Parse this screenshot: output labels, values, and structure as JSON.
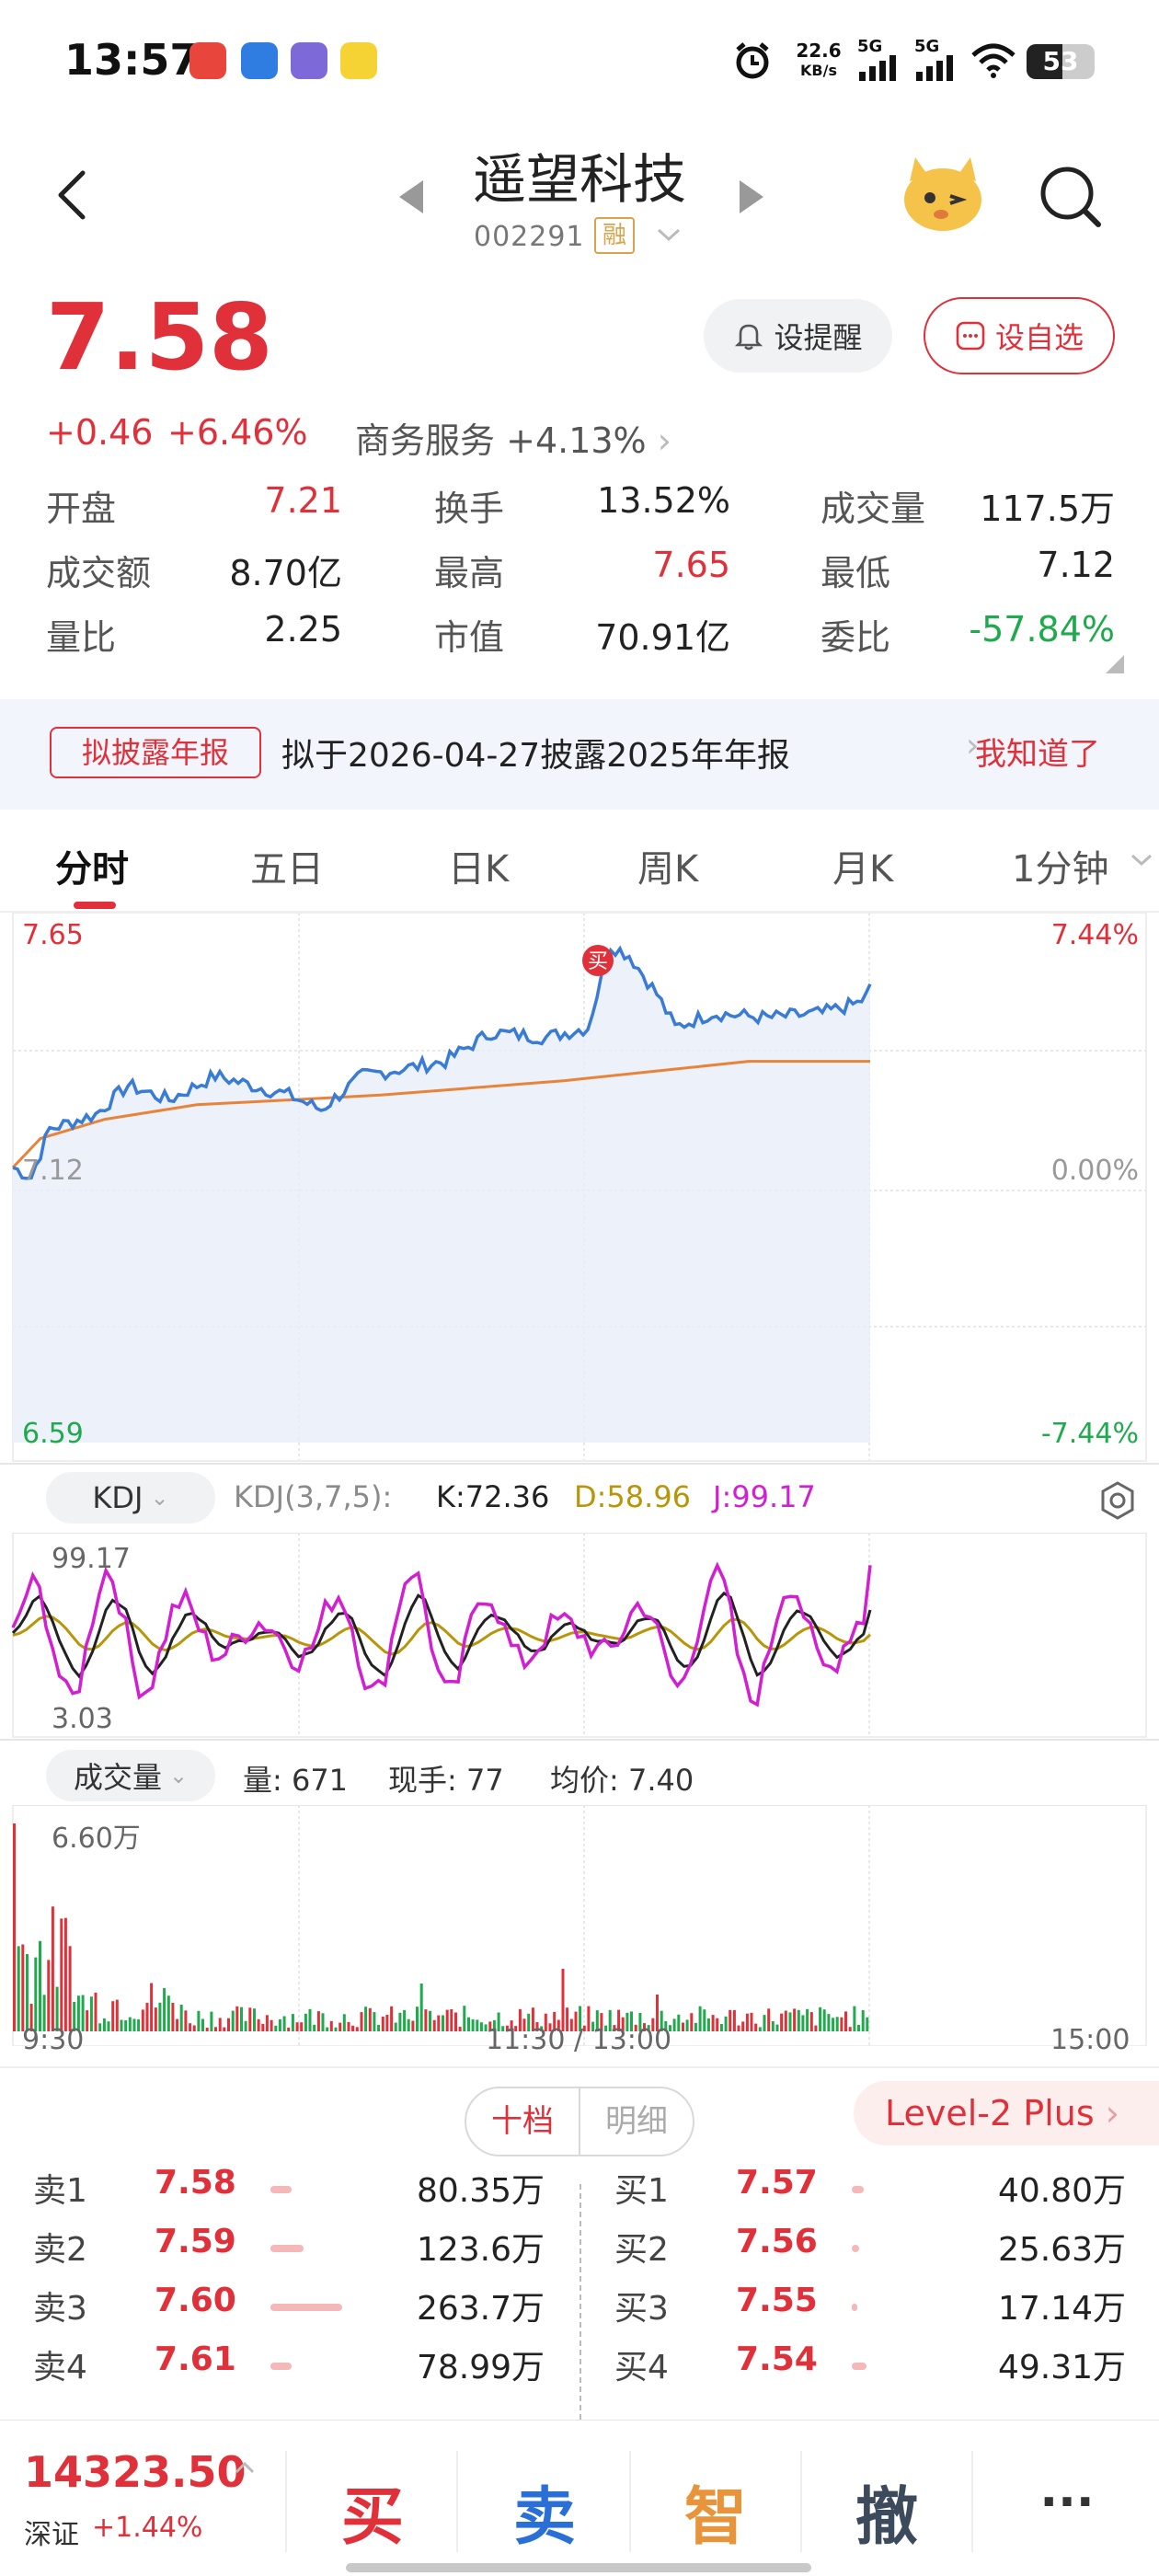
{
  "status_bar": {
    "time": "13:57",
    "net_speed_value": "22.6",
    "net_speed_unit": "KB/s",
    "signal1": "5G",
    "signal2": "5G",
    "battery": "53",
    "icons": [
      "alarm-icon",
      "signal-icon",
      "wifi-icon",
      "battery-icon"
    ]
  },
  "header": {
    "stock_name": "遥望科技",
    "stock_code": "002291",
    "margin_tag": "融",
    "price": "7.58",
    "remind_btn": "设提醒",
    "fav_btn": "设自选",
    "change": "+0.46",
    "change_pct": "+6.46%",
    "sector": "商务服务",
    "sector_pct": "+4.13%"
  },
  "stats": [
    {
      "label": "开盘",
      "value": "7.21",
      "color": "#e0303a"
    },
    {
      "label": "换手",
      "value": "13.52%",
      "color": "#222222"
    },
    {
      "label": "成交量",
      "value": "117.5万",
      "color": "#222222"
    },
    {
      "label": "成交额",
      "value": "8.70亿",
      "color": "#222222"
    },
    {
      "label": "最高",
      "value": "7.65",
      "color": "#e0303a"
    },
    {
      "label": "最低",
      "value": "7.12",
      "color": "#222222"
    },
    {
      "label": "量比",
      "value": "2.25",
      "color": "#222222"
    },
    {
      "label": "市值",
      "value": "70.91亿",
      "color": "#222222"
    },
    {
      "label": "委比",
      "value": "-57.84%",
      "color": "#1faa4d"
    }
  ],
  "banner": {
    "tag": "拟披露年报",
    "text": "拟于2026-04-27披露2025年年报",
    "ok": "我知道了"
  },
  "tabs": [
    "分时",
    "五日",
    "日K",
    "周K",
    "月K",
    "1分钟"
  ],
  "intraday": {
    "y_high": "7.65",
    "y_mid": "7.12",
    "y_low": "6.59",
    "pct_high": "7.44%",
    "pct_mid": "0.00%",
    "pct_low": "-7.44%",
    "buy_marker": "买",
    "x_start": "9:30",
    "x_mid": "11:30 / 13:00",
    "x_end": "15:00"
  },
  "kdj": {
    "name": "KDJ",
    "params": "KDJ(3,7,5):",
    "k": "K:72.36",
    "d": "D:58.96",
    "j": "J:99.17",
    "max": "99.17",
    "min": "3.03"
  },
  "volume": {
    "name": "成交量",
    "vol": "量: 671",
    "hand": "现手: 77",
    "avg": "均价: 7.40",
    "max": "6.60万"
  },
  "orderbook": {
    "seg_on": "十档",
    "seg_off": "明细",
    "level2": "Level-2 Plus",
    "sell": [
      {
        "label": "卖1",
        "price": "7.58",
        "vol": "80.35万",
        "bar": 0.09
      },
      {
        "label": "卖2",
        "price": "7.59",
        "vol": "123.6万",
        "bar": 0.14
      },
      {
        "label": "卖3",
        "price": "7.60",
        "vol": "263.7万",
        "bar": 0.3
      },
      {
        "label": "卖4",
        "price": "7.61",
        "vol": "78.99万",
        "bar": 0.09
      }
    ],
    "buy": [
      {
        "label": "买1",
        "price": "7.57",
        "vol": "40.80万",
        "bar": 0.05
      },
      {
        "label": "买2",
        "price": "7.56",
        "vol": "25.63万",
        "bar": 0.03
      },
      {
        "label": "买3",
        "price": "7.55",
        "vol": "17.14万",
        "bar": 0.02
      },
      {
        "label": "买4",
        "price": "7.54",
        "vol": "49.31万",
        "bar": 0.06
      }
    ]
  },
  "bottom": {
    "index_value": "14323.50",
    "index_name": "深证",
    "index_chg": "+1.44%",
    "buy": "买",
    "sell": "卖",
    "smart": "智",
    "cancel": "撤",
    "more": "···"
  },
  "colors": {
    "up": "#e0303a",
    "down": "#1faa4d",
    "price_line": "#3a7bd5",
    "avg_line": "#e8843a"
  }
}
